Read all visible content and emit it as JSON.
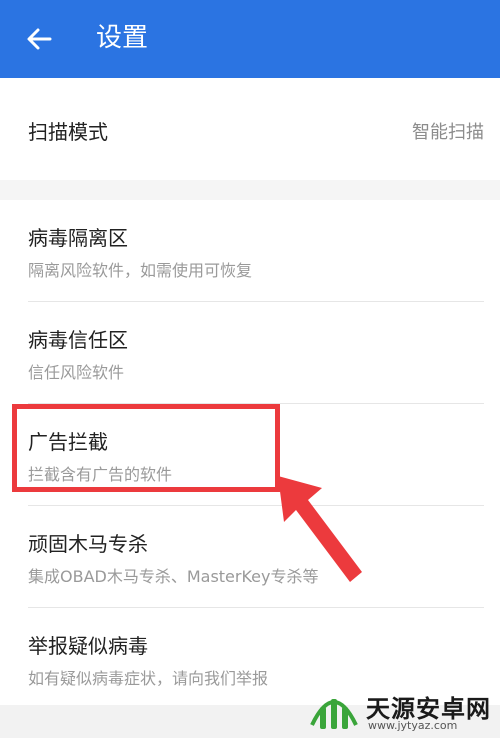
{
  "header": {
    "title": "设置"
  },
  "scan_mode": {
    "label": "扫描模式",
    "value": "智能扫描"
  },
  "items": [
    {
      "title": "病毒隔离区",
      "subtitle": "隔离风险软件，如需使用可恢复"
    },
    {
      "title": "病毒信任区",
      "subtitle": "信任风险软件"
    },
    {
      "title": "广告拦截",
      "subtitle": "拦截含有广告的软件"
    },
    {
      "title": "顽固木马专杀",
      "subtitle": "集成OBAD木马专杀、MasterKey专杀等"
    },
    {
      "title": "举报疑似病毒",
      "subtitle": "如有疑似病毒症状，请向我们举报"
    }
  ],
  "watermark": {
    "brand": "天源安卓网",
    "url": "www.jytyaz.com"
  },
  "colors": {
    "appbar": "#2b74e2",
    "highlight": "#ec3a3d",
    "logo_green": "#3aa53a"
  }
}
